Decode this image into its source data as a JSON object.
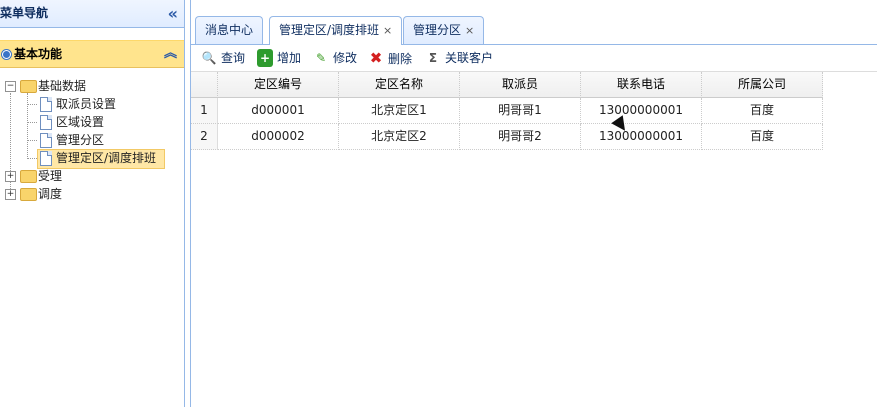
{
  "sidebar": {
    "title": "菜单导航",
    "collapse_icon": "double-chevron-left-icon",
    "accordion_title": "基本功能",
    "accordion_icon": "double-chevron-up-icon",
    "tree": {
      "basic_data": "基础数据",
      "children": [
        "取派员设置",
        "区域设置",
        "管理分区",
        "管理定区/调度排班"
      ],
      "accept": "受理",
      "dispatch": "调度"
    }
  },
  "tabs": [
    {
      "label": "消息中心",
      "closable": false
    },
    {
      "label": "管理定区/调度排班",
      "closable": true,
      "active": true
    },
    {
      "label": "管理分区",
      "closable": true
    }
  ],
  "close_glyph": "×",
  "toolbar": {
    "query": "查询",
    "add": "增加",
    "edit": "修改",
    "delete": "删除",
    "link_customer": "关联客户"
  },
  "grid": {
    "columns": [
      "定区编号",
      "定区名称",
      "取派员",
      "联系电话",
      "所属公司"
    ],
    "rows": [
      {
        "num": "1",
        "cells": [
          "d000001",
          "北京定区1",
          "明哥哥1",
          "13000000001",
          "百度"
        ]
      },
      {
        "num": "2",
        "cells": [
          "d000002",
          "北京定区2",
          "明哥哥2",
          "13000000001",
          "百度"
        ]
      }
    ]
  },
  "colors": {
    "border": "#95b8e7",
    "selected": "#ffe48d",
    "header_text": "#0e2d5f"
  }
}
